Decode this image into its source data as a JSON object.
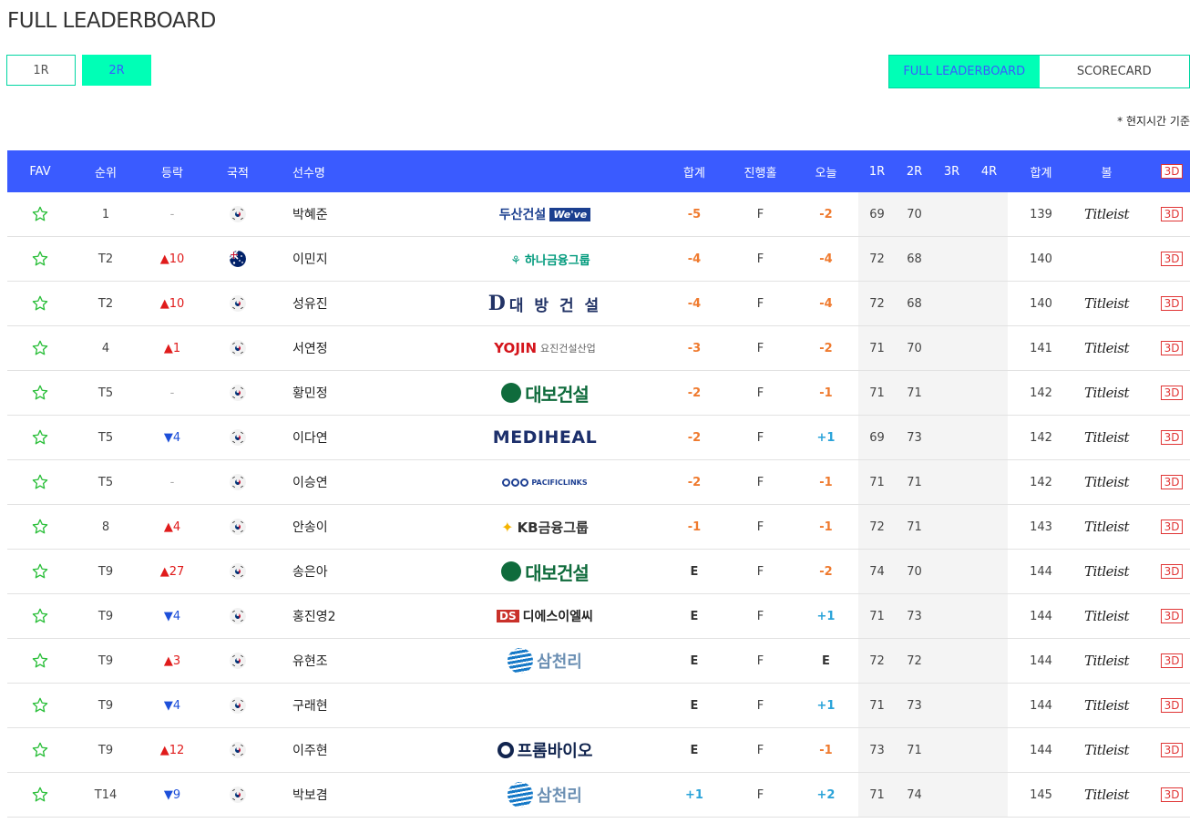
{
  "page": {
    "title": "FULL LEADERBOARD",
    "note": "* 현지시간 기준"
  },
  "round_tabs": [
    {
      "label": "1R",
      "active": false
    },
    {
      "label": "2R",
      "active": true
    }
  ],
  "view_tabs": [
    {
      "label": "FULL LEADERBOARD",
      "active": true
    },
    {
      "label": "SCORECARD",
      "active": false
    }
  ],
  "columns": {
    "fav": "FAV",
    "pos": "순위",
    "move": "등락",
    "nat": "국적",
    "name": "선수명",
    "total": "합계",
    "thru": "진행홀",
    "today": "오늘",
    "r1": "1R",
    "r2": "2R",
    "r3": "3R",
    "r4": "4R",
    "sum": "합계",
    "ball": "볼",
    "view3d": "3D"
  },
  "colors": {
    "header_bg": "#3a5bff",
    "tab_active": "#00ffb6",
    "under_par": "#ef7a2e",
    "over_par": "#2aa3d9",
    "move_up": "#e01b1b",
    "move_down": "#1d4fd9"
  },
  "icons": {
    "fav": "star-outline-icon",
    "move_up": "triangle-up-icon",
    "move_down": "triangle-down-icon",
    "flag_kr": "korea-flag-icon",
    "flag_au": "australia-flag-icon"
  },
  "players": [
    {
      "pos": "1",
      "move_dir": "same",
      "move": "-",
      "nat": "KR",
      "name": "박혜준",
      "sponsor": "doosan",
      "sponsor_text": "두산건설",
      "sponsor_sub": "We've",
      "total": "-5",
      "thru": "F",
      "today": "-2",
      "r1": "69",
      "r2": "70",
      "r3": "",
      "r4": "",
      "sum": "139",
      "ball": "Titleist",
      "view3d": "3D"
    },
    {
      "pos": "T2",
      "move_dir": "up",
      "move": "10",
      "nat": "AU",
      "name": "이민지",
      "sponsor": "hana",
      "sponsor_text": "하나금융그룹",
      "sponsor_sub": "",
      "total": "-4",
      "thru": "F",
      "today": "-4",
      "r1": "72",
      "r2": "68",
      "r3": "",
      "r4": "",
      "sum": "140",
      "ball": "",
      "view3d": "3D"
    },
    {
      "pos": "T2",
      "move_dir": "up",
      "move": "10",
      "nat": "KR",
      "name": "성유진",
      "sponsor": "daebang",
      "sponsor_text": "대 방 건 설",
      "sponsor_sub": "D",
      "total": "-4",
      "thru": "F",
      "today": "-4",
      "r1": "72",
      "r2": "68",
      "r3": "",
      "r4": "",
      "sum": "140",
      "ball": "Titleist",
      "view3d": "3D"
    },
    {
      "pos": "4",
      "move_dir": "up",
      "move": "1",
      "nat": "KR",
      "name": "서연정",
      "sponsor": "yojin",
      "sponsor_text": "YOJIN",
      "sponsor_sub": "요진건설산업",
      "total": "-3",
      "thru": "F",
      "today": "-2",
      "r1": "71",
      "r2": "70",
      "r3": "",
      "r4": "",
      "sum": "141",
      "ball": "Titleist",
      "view3d": "3D"
    },
    {
      "pos": "T5",
      "move_dir": "same",
      "move": "-",
      "nat": "KR",
      "name": "황민정",
      "sponsor": "daebo",
      "sponsor_text": "대보건설",
      "sponsor_sub": "",
      "total": "-2",
      "thru": "F",
      "today": "-1",
      "r1": "71",
      "r2": "71",
      "r3": "",
      "r4": "",
      "sum": "142",
      "ball": "Titleist",
      "view3d": "3D"
    },
    {
      "pos": "T5",
      "move_dir": "down",
      "move": "4",
      "nat": "KR",
      "name": "이다연",
      "sponsor": "mediheal",
      "sponsor_text": "MEDIHEAL",
      "sponsor_sub": "",
      "total": "-2",
      "thru": "F",
      "today": "+1",
      "r1": "69",
      "r2": "73",
      "r3": "",
      "r4": "",
      "sum": "142",
      "ball": "Titleist",
      "view3d": "3D"
    },
    {
      "pos": "T5",
      "move_dir": "same",
      "move": "-",
      "nat": "KR",
      "name": "이승연",
      "sponsor": "pacific",
      "sponsor_text": "PACIFICLINKS",
      "sponsor_sub": "",
      "total": "-2",
      "thru": "F",
      "today": "-1",
      "r1": "71",
      "r2": "71",
      "r3": "",
      "r4": "",
      "sum": "142",
      "ball": "Titleist",
      "view3d": "3D"
    },
    {
      "pos": "8",
      "move_dir": "up",
      "move": "4",
      "nat": "KR",
      "name": "안송이",
      "sponsor": "kb",
      "sponsor_text": "KB금융그룹",
      "sponsor_sub": "",
      "total": "-1",
      "thru": "F",
      "today": "-1",
      "r1": "72",
      "r2": "71",
      "r3": "",
      "r4": "",
      "sum": "143",
      "ball": "Titleist",
      "view3d": "3D"
    },
    {
      "pos": "T9",
      "move_dir": "up",
      "move": "27",
      "nat": "KR",
      "name": "송은아",
      "sponsor": "daebo",
      "sponsor_text": "대보건설",
      "sponsor_sub": "",
      "total": "E",
      "thru": "F",
      "today": "-2",
      "r1": "74",
      "r2": "70",
      "r3": "",
      "r4": "",
      "sum": "144",
      "ball": "Titleist",
      "view3d": "3D"
    },
    {
      "pos": "T9",
      "move_dir": "down",
      "move": "4",
      "nat": "KR",
      "name": "홍진영2",
      "sponsor": "ds",
      "sponsor_text": "디에스이엘씨",
      "sponsor_sub": "DS",
      "total": "E",
      "thru": "F",
      "today": "+1",
      "r1": "71",
      "r2": "73",
      "r3": "",
      "r4": "",
      "sum": "144",
      "ball": "Titleist",
      "view3d": "3D"
    },
    {
      "pos": "T9",
      "move_dir": "up",
      "move": "3",
      "nat": "KR",
      "name": "유현조",
      "sponsor": "samchully",
      "sponsor_text": "삼천리",
      "sponsor_sub": "",
      "total": "E",
      "thru": "F",
      "today": "E",
      "r1": "72",
      "r2": "72",
      "r3": "",
      "r4": "",
      "sum": "144",
      "ball": "Titleist",
      "view3d": "3D"
    },
    {
      "pos": "T9",
      "move_dir": "down",
      "move": "4",
      "nat": "KR",
      "name": "구래현",
      "sponsor": "",
      "sponsor_text": "",
      "sponsor_sub": "",
      "total": "E",
      "thru": "F",
      "today": "+1",
      "r1": "71",
      "r2": "73",
      "r3": "",
      "r4": "",
      "sum": "144",
      "ball": "Titleist",
      "view3d": "3D"
    },
    {
      "pos": "T9",
      "move_dir": "up",
      "move": "12",
      "nat": "KR",
      "name": "이주현",
      "sponsor": "prom",
      "sponsor_text": "프롬바이오",
      "sponsor_sub": "",
      "total": "E",
      "thru": "F",
      "today": "-1",
      "r1": "73",
      "r2": "71",
      "r3": "",
      "r4": "",
      "sum": "144",
      "ball": "Titleist",
      "view3d": "3D"
    },
    {
      "pos": "T14",
      "move_dir": "down",
      "move": "9",
      "nat": "KR",
      "name": "박보겸",
      "sponsor": "samchully",
      "sponsor_text": "삼천리",
      "sponsor_sub": "",
      "total": "+1",
      "thru": "F",
      "today": "+2",
      "r1": "71",
      "r2": "74",
      "r3": "",
      "r4": "",
      "sum": "145",
      "ball": "Titleist",
      "view3d": "3D"
    }
  ]
}
